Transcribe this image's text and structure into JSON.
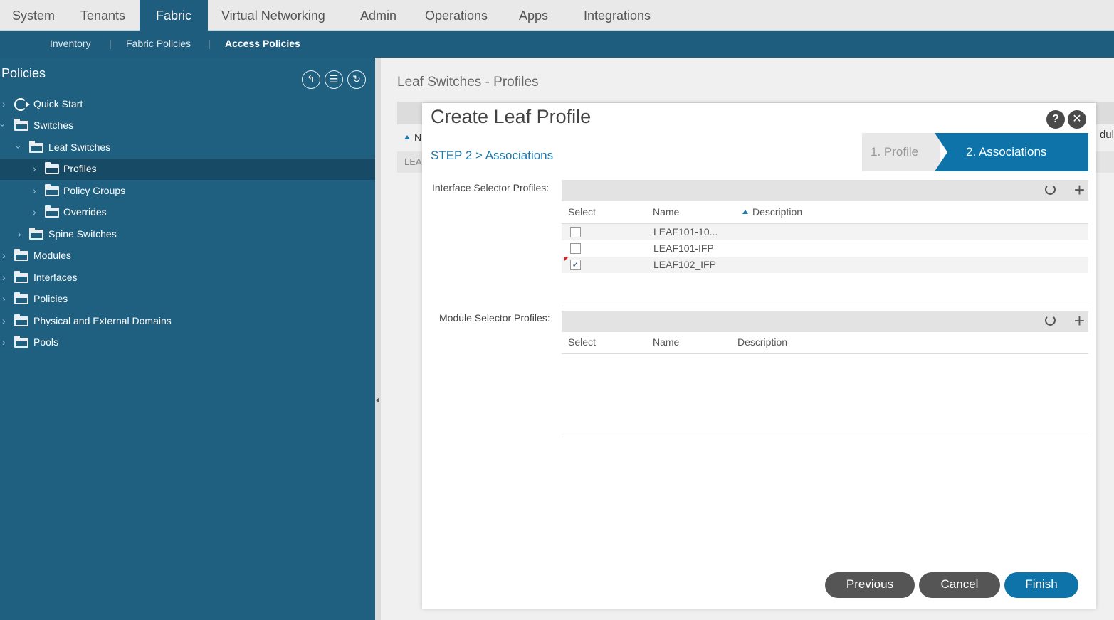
{
  "topnav": {
    "tabs": [
      {
        "label": "System"
      },
      {
        "label": "Tenants"
      },
      {
        "label": "Fabric",
        "active": true
      },
      {
        "label": "Virtual Networking"
      },
      {
        "label": "Admin"
      },
      {
        "label": "Operations"
      },
      {
        "label": "Apps"
      },
      {
        "label": "Integrations"
      }
    ]
  },
  "subnav": {
    "items": [
      "Inventory",
      "Fabric Policies",
      "Access Policies"
    ],
    "separator": "|",
    "active": "Access Policies"
  },
  "sidebar": {
    "title": "Policies",
    "icons": [
      "quick-start-icon",
      "filter-icon",
      "refresh-icon"
    ],
    "tree": [
      {
        "label": "Quick Start"
      },
      {
        "label": "Switches"
      },
      {
        "label": "Leaf Switches"
      },
      {
        "label": "Profiles",
        "selected": true
      },
      {
        "label": "Policy Groups"
      },
      {
        "label": "Overrides"
      },
      {
        "label": "Spine Switches"
      },
      {
        "label": "Modules"
      },
      {
        "label": "Interfaces"
      },
      {
        "label": "Policies"
      },
      {
        "label": "Physical and External Domains"
      },
      {
        "label": "Pools"
      }
    ]
  },
  "main": {
    "page_title": "Leaf Switches - Profiles",
    "bg_sort_text": "N",
    "bg_row_text": "LEA",
    "bg_right_text": "dul"
  },
  "modal": {
    "title": "Create Leaf Profile",
    "help": "?",
    "close": "✕",
    "step_label": "STEP 2 > Associations",
    "wizard": {
      "step1": "1. Profile",
      "step2": "2. Associations"
    },
    "interface_selectors": {
      "label": "Interface Selector Profiles:",
      "columns": [
        "Select",
        "Name",
        "Description"
      ],
      "rows": [
        {
          "name": "LEAF101-10...",
          "checked": false
        },
        {
          "name": "LEAF101-IFP",
          "checked": false
        },
        {
          "name": "LEAF102_IFP",
          "checked": true
        }
      ]
    },
    "module_selectors": {
      "label": "Module Selector Profiles:",
      "columns": [
        "Select",
        "Name",
        "Description"
      ]
    },
    "buttons": {
      "previous": "Previous",
      "cancel": "Cancel",
      "finish": "Finish"
    }
  },
  "colors": {
    "nav_blue": "#1e5d7e",
    "accent": "#0d73a8"
  }
}
